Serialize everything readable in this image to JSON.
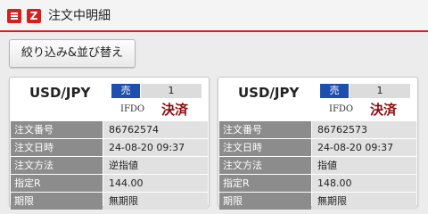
{
  "header": {
    "menu_icon": "menu-icon",
    "logo_icon_text": "Z",
    "title": "注文中明細",
    "accent": "#d91e1e"
  },
  "toolbar": {
    "sort_label": "絞り込み&並び替え"
  },
  "orders": [
    {
      "pair": "USD/JPY",
      "side": "売",
      "side_color": "#1f4fae",
      "quantity": "1",
      "order_type": "IFDO",
      "status": "決済",
      "fields": [
        {
          "label": "注文番号",
          "value": "86762574"
        },
        {
          "label": "注文日時",
          "value": "24-08-20 09:37"
        },
        {
          "label": "注文方法",
          "value": "逆指値"
        },
        {
          "label": "指定R",
          "value": "144.00"
        },
        {
          "label": "期限",
          "value": "無期限"
        }
      ]
    },
    {
      "pair": "USD/JPY",
      "side": "売",
      "side_color": "#1f4fae",
      "quantity": "1",
      "order_type": "IFDO",
      "status": "決済",
      "fields": [
        {
          "label": "注文番号",
          "value": "86762573"
        },
        {
          "label": "注文日時",
          "value": "24-08-20 09:37"
        },
        {
          "label": "注文方法",
          "value": "指値"
        },
        {
          "label": "指定R",
          "value": "148.00"
        },
        {
          "label": "期限",
          "value": "無期限"
        }
      ]
    }
  ]
}
